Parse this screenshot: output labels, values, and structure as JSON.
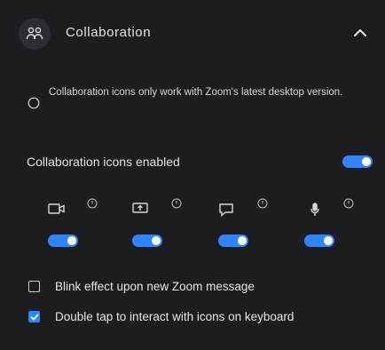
{
  "header": {
    "title": "Collaboration",
    "icon": "collaboration-icon",
    "collapse_icon": "chevron-up-icon"
  },
  "info": {
    "text": "Collaboration icons only work with Zoom's latest desktop version.",
    "icon": "info-icon"
  },
  "enabled": {
    "label": "Collaboration icons enabled",
    "on": true
  },
  "features": [
    {
      "icon": "video-camera-icon",
      "on": true
    },
    {
      "icon": "share-screen-icon",
      "on": true
    },
    {
      "icon": "chat-icon",
      "on": true
    },
    {
      "icon": "microphone-icon",
      "on": true
    }
  ],
  "options": [
    {
      "label": "Blink effect upon new Zoom message",
      "checked": false
    },
    {
      "label": "Double tap to interact with icons on keyboard",
      "checked": true
    }
  ],
  "colors": {
    "accent": "#2e85ff",
    "background": "#1b1d20"
  }
}
